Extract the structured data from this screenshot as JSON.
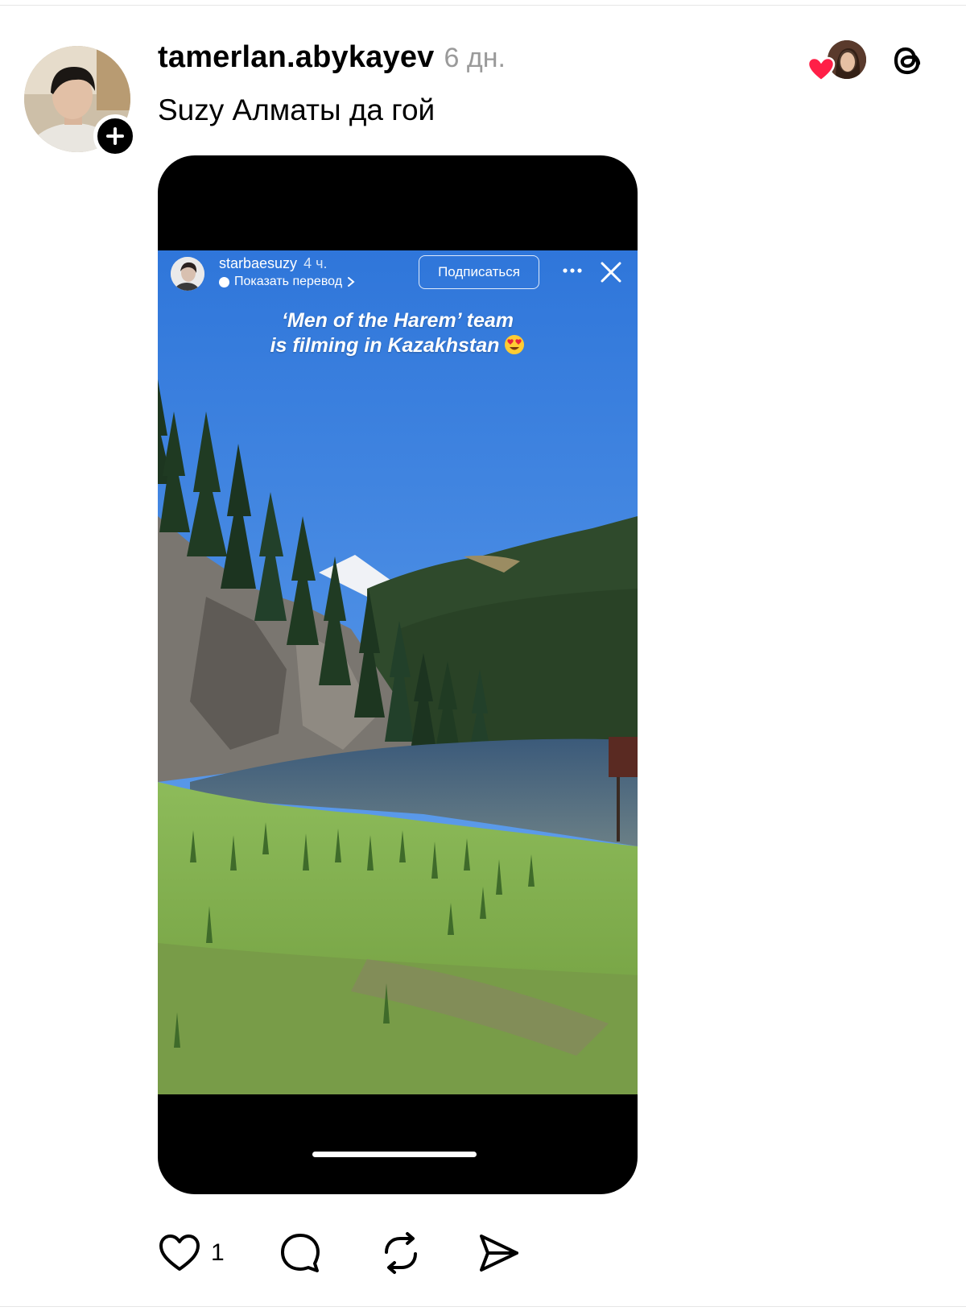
{
  "post": {
    "username": "tamerlan.abykayev",
    "time": "6 дн.",
    "caption": "Suzy Алматы да гой",
    "likes": "1"
  },
  "story": {
    "username": "starbaesuzy",
    "time": "4 ч.",
    "translate": "Показать перевод",
    "subscribe": "Подписаться",
    "text_line1": "‘Men of the Harem’ team",
    "text_line2": "is filming in Kazakhstan"
  },
  "icons": {
    "follow": "plus-icon",
    "liker": "heart-icon",
    "app": "threads-icon",
    "like": "heart-outline-icon",
    "comment": "comment-icon",
    "repost": "repost-icon",
    "share": "send-icon",
    "more": "ellipsis-icon",
    "close": "close-icon",
    "emoji": "heart-eyes-emoji"
  },
  "colors": {
    "heart": "#ff1f47",
    "sky": "#3a7fe0",
    "grass": "#7cae44"
  }
}
